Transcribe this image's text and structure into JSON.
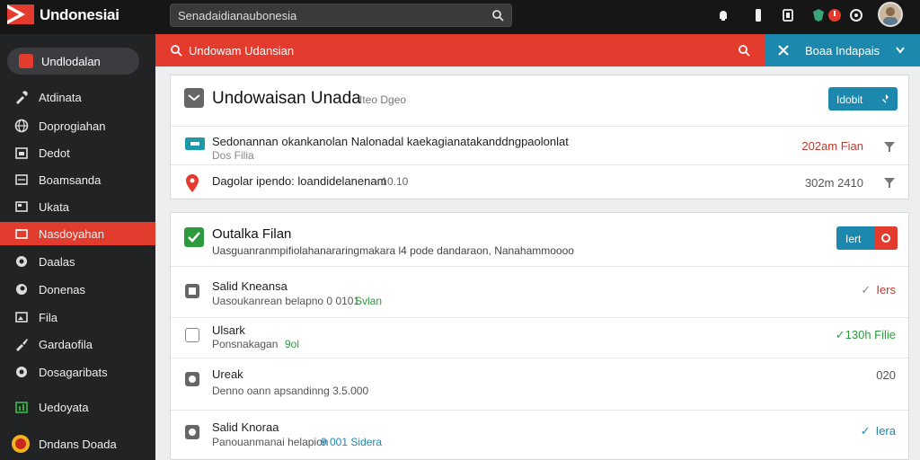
{
  "app": {
    "title": "Undonesiai"
  },
  "search": {
    "value": "Senadaidianaubonesia"
  },
  "colors": {
    "brand_red": "#e43b2f",
    "teal": "#1c88ad",
    "sidebar": "#222325",
    "topbar": "#161616",
    "green": "#2e9a3e"
  },
  "sidebar": {
    "top_item": {
      "label": "Undlodalan",
      "icon": "app-icon"
    },
    "items": [
      {
        "label": "Atdinata",
        "icon": "wrench-icon"
      },
      {
        "label": "Doprogiahan",
        "icon": "globe-icon"
      },
      {
        "label": "Dedot",
        "icon": "calendar-icon"
      },
      {
        "label": "Boamsanda",
        "icon": "list-icon"
      },
      {
        "label": "Ukata",
        "icon": "card-icon"
      },
      {
        "label": "Nasdoyahan",
        "icon": "folder-icon",
        "active": true
      },
      {
        "label": "Daalas",
        "icon": "chat-icon"
      },
      {
        "label": "Donenas",
        "icon": "circle-icon"
      },
      {
        "label": "Fila",
        "icon": "image-icon"
      },
      {
        "label": "Gardaofila",
        "icon": "brush-icon"
      },
      {
        "label": "Dosagaribats",
        "icon": "clock-icon"
      },
      {
        "label": "Uedoyata",
        "icon": "chart-icon"
      },
      {
        "label": "Dndans Doada",
        "icon": "emblem-icon"
      }
    ]
  },
  "redbar": {
    "label": "Undowam Udansian"
  },
  "tealbar": {
    "label": "Boaa Indapais"
  },
  "card1": {
    "title": "Undowaisan Unada",
    "subtitle": "Iteo Dgeo",
    "button": "Idobit",
    "rows": [
      {
        "title": "Sedonannan okankanolan Nalonadal kaekagianatakanddngpaolonlat",
        "sub": "Dos Filia",
        "meta": "202am Fian",
        "meta_color": "#c0392b"
      },
      {
        "title": "Dagolar ipendo: loandidelanenam",
        "sub": "· 10.10",
        "meta": "302m 2410",
        "meta_color": "#555555"
      }
    ]
  },
  "card2": {
    "title": "Outalka Filan",
    "subtitle": "Uasguanranmpifiolahanararingmakara l4 pode dandaraon, Nanahammoooo",
    "button": "Iert",
    "rows": [
      {
        "title": "Salid Kneansa",
        "sub": "Uasoukanrean belapno 0 0101",
        "tag": "Svlan",
        "tag_color": "#2e9a3e",
        "meta": "Iers",
        "meta_prefix": "✓",
        "meta_color": "#c0392b"
      },
      {
        "title": "Ulsark",
        "sub": "Ponsnakagan",
        "tag": "9ol",
        "tag_color": "#2e9a3e",
        "meta": "130h Filie",
        "meta_prefix": "✓",
        "meta_color": "#2e9a3e"
      },
      {
        "title": "Ureak",
        "sub": "Denno oann apsandinng 3.5.000",
        "tag": "",
        "tag_color": "#2e9a3e",
        "meta": "020",
        "meta_prefix": "",
        "meta_color": "#555555"
      },
      {
        "title": "Salid Knoraa",
        "sub": "Panouanmanai helapion",
        "tag": "9 001 Sidera",
        "tag_color": "#1c88ad",
        "meta": "Iera",
        "meta_prefix": "✓",
        "meta_color": "#1c88ad"
      }
    ]
  }
}
